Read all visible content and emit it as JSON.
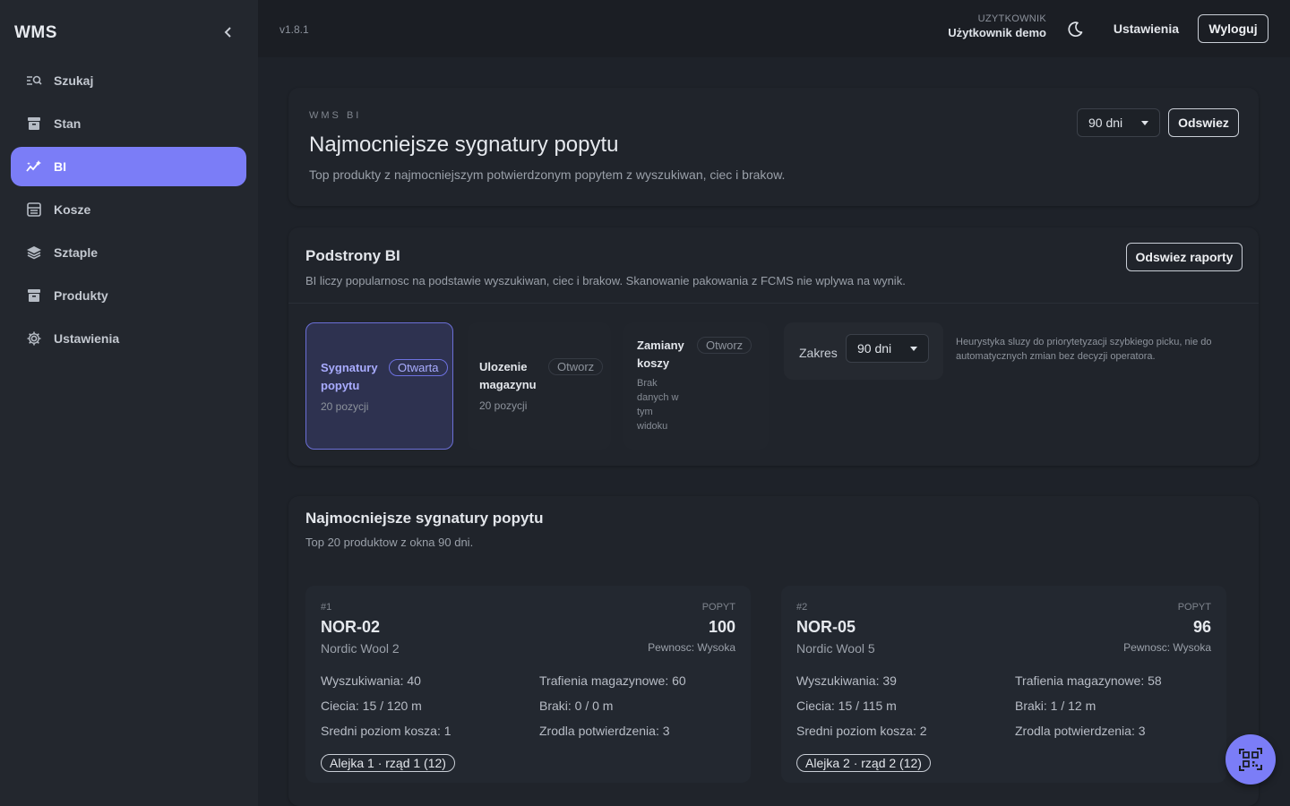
{
  "app": {
    "brand": "WMS",
    "version": "v1.8.1"
  },
  "sidebar": {
    "items": [
      {
        "label": "Szukaj",
        "icon": "search-list-icon"
      },
      {
        "label": "Stan",
        "icon": "archive-icon"
      },
      {
        "label": "BI",
        "icon": "chart-sparkle-icon",
        "active": true
      },
      {
        "label": "Kosze",
        "icon": "basket-grid-icon"
      },
      {
        "label": "Sztaple",
        "icon": "layers-icon"
      },
      {
        "label": "Produkty",
        "icon": "box-icon"
      },
      {
        "label": "Ustawienia",
        "icon": "gear-icon"
      }
    ]
  },
  "topbar": {
    "user_label": "UZYTKOWNIK",
    "user_name": "Użytkownik demo",
    "settings_label": "Ustawienia",
    "logout_label": "Wyloguj"
  },
  "hero": {
    "overline": "WMS BI",
    "title": "Najmocniejsze sygnatury popytu",
    "subtitle": "Top produkty z najmocniejszym potwierdzonym popytem z wyszukiwan, ciec i brakow.",
    "range_value": "90 dni",
    "refresh_label": "Odswiez"
  },
  "subpages": {
    "title": "Podstrony BI",
    "description": "BI liczy popularnosc na podstawie wyszukiwan, ciec i brakow. Skanowanie pakowania z FCMS nie wplywa na wynik.",
    "refresh_label": "Odswiez raporty",
    "tiles": [
      {
        "name_line1": "Sygnatury",
        "name_line2": "popytu",
        "badge": "Otwarta",
        "count": "20 pozycji"
      },
      {
        "name_line1": "Ulozenie",
        "name_line2": "magazynu",
        "badge": "Otworz",
        "count": "20 pozycji"
      },
      {
        "name_line1": "Zamiany",
        "name_line2": "koszy",
        "badge": "Otworz",
        "note": [
          "Brak",
          "danych w",
          "tym",
          "widoku"
        ]
      }
    ],
    "range_label": "Zakres",
    "range_value": "90 dni",
    "heuristic_note": "Heurystyka sluzy do priorytetyzacji szybkiego picku, nie do automatycznych zmian bez decyzji operatora."
  },
  "top_section": {
    "title": "Najmocniejsze sygnatury popytu",
    "subtitle": "Top 20 produktow z okna 90 dni.",
    "products": [
      {
        "rank": "#1",
        "code": "NOR-02",
        "name": "Nordic Wool 2",
        "popyt_label": "POPYT",
        "popyt": "100",
        "confidence": "Pewnosc: Wysoka",
        "searches": "Wyszukiwania: 40",
        "hits": "Trafienia magazynowe: 60",
        "cuts": "Ciecia: 15 / 120 m",
        "shortages": "Braki: 0 / 0 m",
        "avg_level": "Sredni poziom kosza: 1",
        "sources": "Zrodla potwierdzenia: 3",
        "location": "Alejka 1 · rząd 1 (12)"
      },
      {
        "rank": "#2",
        "code": "NOR-05",
        "name": "Nordic Wool 5",
        "popyt_label": "POPYT",
        "popyt": "96",
        "confidence": "Pewnosc: Wysoka",
        "searches": "Wyszukiwania: 39",
        "hits": "Trafienia magazynowe: 58",
        "cuts": "Ciecia: 15 / 115 m",
        "shortages": "Braki: 1 / 12 m",
        "avg_level": "Sredni poziom kosza: 2",
        "sources": "Zrodla potwierdzenia: 3",
        "location": "Alejka 2 · rząd 2 (12)"
      }
    ]
  },
  "fab": {
    "icon": "qr-scan-icon"
  },
  "colors": {
    "accent": "#7b7df7",
    "background": "#1e2229",
    "sidebar": "#23272e"
  }
}
